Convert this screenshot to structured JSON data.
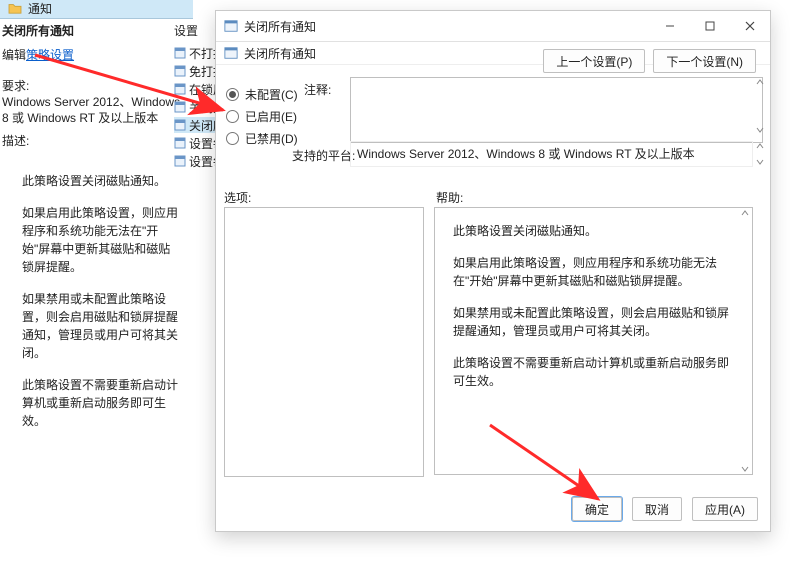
{
  "explorer": {
    "folder_label": "通知"
  },
  "left": {
    "title": "关闭所有通知",
    "edit_prefix": "编辑",
    "edit_link": "策略设置",
    "requirements": "要求:\nWindows Server 2012、Windows 8 或 Windows RT 及以上版本",
    "desc_label": "描述:",
    "desc": [
      "此策略设置关闭磁贴通知。",
      "如果启用此策略设置，则应用程序和系统功能无法在\"开始\"屏幕中更新其磁贴和磁贴锁屏提醒。",
      "如果禁用或未配置此策略设置，则会启用磁贴和锁屏提醒通知，管理员或用户可将其关闭。",
      "此策略设置不需要重新启动计算机或重新启动服务即可生效。"
    ]
  },
  "tree": {
    "header": "设置",
    "items": [
      "不打扰",
      "免打扰",
      "在锁屏",
      "关闭免",
      "关闭所",
      "设置每",
      "设置每"
    ],
    "selected_index": 4
  },
  "dialog": {
    "title": "关闭所有通知",
    "subheader": "关闭所有通知",
    "prev_btn": "上一个设置(P)",
    "next_btn": "下一个设置(N)",
    "radios": {
      "not_configured": "未配置(C)",
      "enabled": "已启用(E)",
      "disabled": "已禁用(D)",
      "selected": "not_configured"
    },
    "comment_label": "注释:",
    "comment_value": "",
    "platform_label": "支持的平台:",
    "platform_value": "Windows Server 2012、Windows 8 或 Windows RT 及以上版本",
    "options_label": "选项:",
    "help_label": "帮助:",
    "help_text": [
      "此策略设置关闭磁贴通知。",
      "如果启用此策略设置，则应用程序和系统功能无法在\"开始\"屏幕中更新其磁贴和磁贴锁屏提醒。",
      "如果禁用或未配置此策略设置，则会启用磁贴和锁屏提醒通知，管理员或用户可将其关闭。",
      "此策略设置不需要重新启动计算机或重新启动服务即可生效。"
    ],
    "ok_btn": "确定",
    "cancel_btn": "取消",
    "apply_btn": "应用(A)"
  },
  "icons": {
    "folder": "folder-icon",
    "setting": "setting-item-icon",
    "app": "app-icon"
  },
  "colors": {
    "arrow": "#ff2a2a",
    "selection": "#cfe8f7",
    "link": "#0a5ecb"
  }
}
